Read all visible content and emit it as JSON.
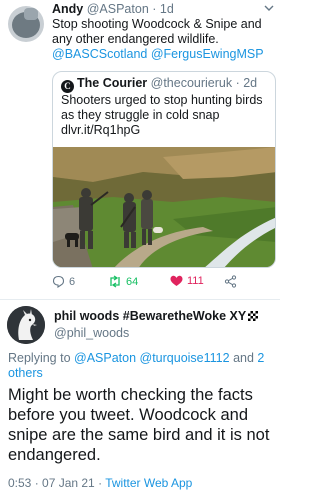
{
  "tweet1": {
    "name": "Andy",
    "handle": "@ASPaton",
    "separator": " · ",
    "time": "1d",
    "text": "Stop shooting Woodcock & Snipe and any other endangered wildlife.",
    "tags": "@BASCScotland @FergusEwingMSP",
    "quote": {
      "logo_letter": "C",
      "name": "The Courier",
      "handle": "@thecourieruk",
      "separator": " · ",
      "time": "2d",
      "text": "Shooters urged to stop hunting birds as they struggle in cold snap dlvr.it/Rq1hpG"
    },
    "actions": {
      "reply_count": "6",
      "retweet_count": "64",
      "like_count": "111"
    }
  },
  "tweet2": {
    "name": "phil woods #BewaretheWoke XY",
    "handle": "@phil_woods",
    "replying_prefix": "Replying to ",
    "replying_tags": "@ASPaton @turquoise1112",
    "replying_and": " and ",
    "replying_others": "2 others",
    "text": "Might be worth checking the facts before you tweet. Woodcock and snipe are the same bird and it is not endangered.",
    "timestamp": "0:53 · 07 Jan 21 · ",
    "source": "Twitter Web App"
  },
  "colors": {
    "link": "#1b95e0",
    "muted": "#657786",
    "retweet": "#17bf63",
    "like": "#e0245e"
  }
}
